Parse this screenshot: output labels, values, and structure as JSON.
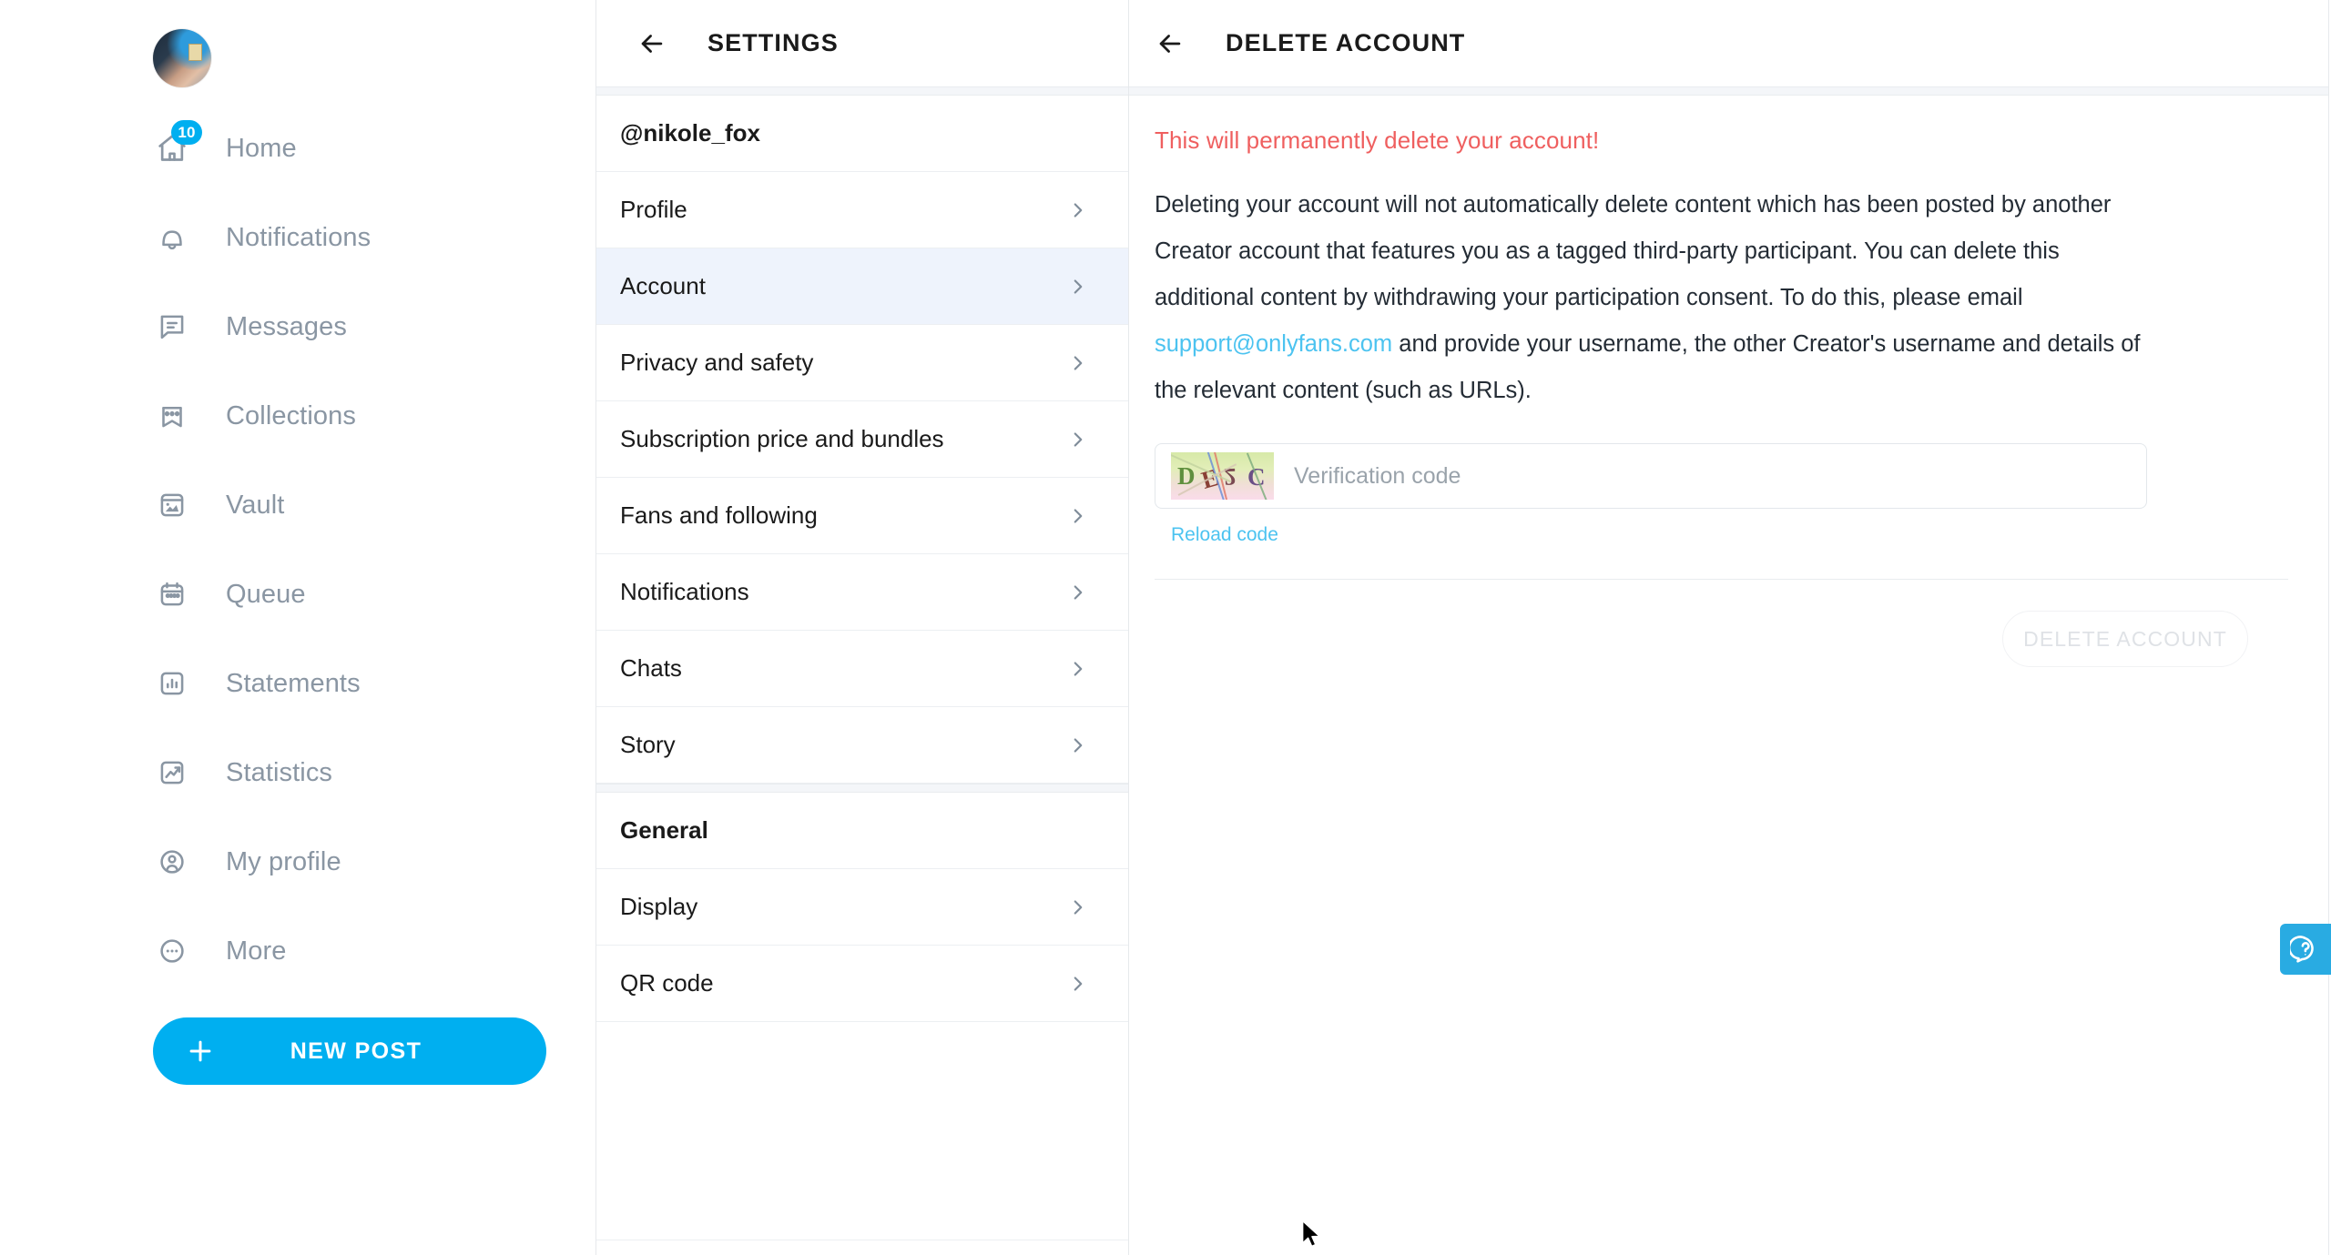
{
  "sidebar": {
    "avatar_name": "user-avatar",
    "items": [
      {
        "label": "Home",
        "icon": "home-icon",
        "badge": "10"
      },
      {
        "label": "Notifications",
        "icon": "bell-icon",
        "badge": ""
      },
      {
        "label": "Messages",
        "icon": "message-icon",
        "badge": ""
      },
      {
        "label": "Collections",
        "icon": "bookmark-star-icon",
        "badge": ""
      },
      {
        "label": "Vault",
        "icon": "image-box-icon",
        "badge": ""
      },
      {
        "label": "Queue",
        "icon": "calendar-icon",
        "badge": ""
      },
      {
        "label": "Statements",
        "icon": "bar-chart-icon",
        "badge": ""
      },
      {
        "label": "Statistics",
        "icon": "trend-up-icon",
        "badge": ""
      },
      {
        "label": "My profile",
        "icon": "person-circle-icon",
        "badge": ""
      },
      {
        "label": "More",
        "icon": "ellipsis-circle-icon",
        "badge": ""
      }
    ],
    "new_post_label": "NEW POST"
  },
  "settings_panel": {
    "title": "SETTINGS",
    "username": "@nikole_fox",
    "items": [
      {
        "label": "Profile",
        "active": false
      },
      {
        "label": "Account",
        "active": true
      },
      {
        "label": "Privacy and safety",
        "active": false
      },
      {
        "label": "Subscription price and bundles",
        "active": false
      },
      {
        "label": "Fans and following",
        "active": false
      },
      {
        "label": "Notifications",
        "active": false
      },
      {
        "label": "Chats",
        "active": false
      },
      {
        "label": "Story",
        "active": false
      }
    ],
    "section_general": "General",
    "general_items": [
      {
        "label": "Display",
        "active": false
      },
      {
        "label": "QR code",
        "active": false
      }
    ]
  },
  "content": {
    "title": "DELETE ACCOUNT",
    "warning": "This will permanently delete your account!",
    "paragraph_part1": "Deleting your account will not automatically delete content which has been posted by another Creator account that features you as a tagged third-party participant. You can delete this additional content by withdrawing your participation consent. To do this, please email ",
    "support_email": "support@onlyfans.com",
    "paragraph_part2": " and provide your username, the other Creator's username and details of the relevant content (such as URLs).",
    "captcha_text": "DE2C",
    "captcha_chars": [
      "D",
      "E",
      "2",
      "C"
    ],
    "verification_placeholder": "Verification code",
    "verification_value": "",
    "reload_label": "Reload code",
    "delete_button_label": "DELETE ACCOUNT"
  },
  "help": {
    "icon": "help-question-icon"
  },
  "colors": {
    "accent": "#00aff0",
    "link": "#4cc3f0",
    "warning": "#ef5f5f",
    "nav_text": "#8a96a3",
    "active_row": "#eef3fc",
    "help_fab": "#29abe2"
  }
}
